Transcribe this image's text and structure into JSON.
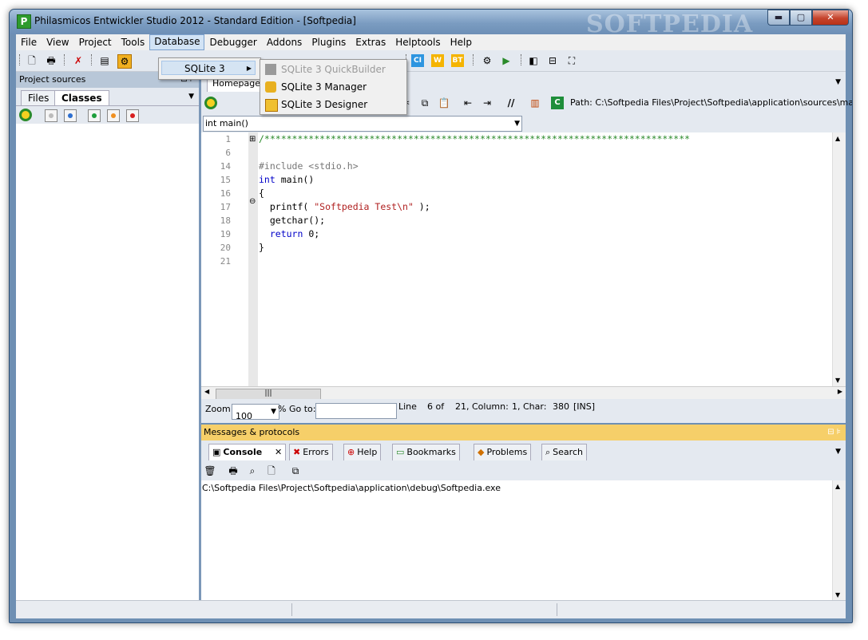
{
  "window": {
    "title": "Philasmicos Entwickler Studio 2012 - Standard Edition - [Softpedia]",
    "watermark": "SOFTPEDIA",
    "app_icon_letter": "P"
  },
  "window_buttons": {
    "minimize": "▬",
    "maximize": "▢",
    "close": "✕"
  },
  "menubar": {
    "items": [
      "File",
      "View",
      "Project",
      "Tools",
      "Database",
      "Debugger",
      "Addons",
      "Plugins",
      "Extras",
      "Helptools",
      "Help"
    ],
    "active": "Database"
  },
  "database_menu": {
    "item": "SQLite 3"
  },
  "sqlite_submenu": {
    "items": [
      {
        "label": "SQLite 3 QuickBuilder",
        "enabled": false
      },
      {
        "label": "SQLite 3 Manager",
        "enabled": true
      },
      {
        "label": "SQLite 3 Designer",
        "enabled": true
      }
    ]
  },
  "toolbar": {
    "icons": [
      "new-file-icon",
      "print-icon",
      "delete-icon",
      "window-icon",
      "build-icon",
      "ci-icon",
      "w-icon",
      "bt-icon",
      "compile-icon",
      "run-icon",
      "layout-left-icon",
      "layout-split-icon",
      "fullscreen-icon"
    ],
    "badges": {
      "ci": "CI",
      "w": "W",
      "bt": "BT"
    }
  },
  "project_panel": {
    "title": "Project sources",
    "tabs": [
      "Files",
      "Classes"
    ],
    "active_tab": "Classes",
    "pin_glyph": "⊟ ⊧"
  },
  "editor": {
    "tab": "Homepage",
    "path_label": "Path: C:\\Softpedia Files\\Project\\Softpedia\\application\\sources\\main.cpp",
    "function_select": "int main()",
    "line_numbers": [
      "1",
      "6",
      "14",
      "15",
      "16",
      "17",
      "18",
      "19",
      "20",
      "21"
    ],
    "code_lines": [
      {
        "type": "comment",
        "text": "/*****************************************************************************"
      },
      {
        "type": "plain",
        "text": ""
      },
      {
        "type": "pre",
        "text": "#include <stdio.h>"
      },
      {
        "type": "kwline",
        "kw": "int",
        "rest": " main()"
      },
      {
        "type": "plain",
        "text": "{"
      },
      {
        "type": "strline",
        "pre": "  printf( ",
        "str": "\"Softpedia Test\\n\"",
        "post": " );"
      },
      {
        "type": "plain",
        "text": "  getchar();"
      },
      {
        "type": "kwline",
        "kw": "  return",
        "rest": " 0;"
      },
      {
        "type": "plain",
        "text": "}"
      },
      {
        "type": "plain",
        "text": ""
      }
    ],
    "fold_markers": {
      "open": "⊞",
      "close": "⊖"
    }
  },
  "status": {
    "zoom_label": "Zoom:",
    "zoom_value": "100",
    "goto_label": "% Go to:",
    "line_label": "Line",
    "line": "6 of",
    "total": "21, Column:",
    "column": "1, Char:",
    "char": "380",
    "mode": "[INS]"
  },
  "messages": {
    "title": "Messages & protocols",
    "tabs": [
      {
        "label": "Console",
        "icon": "console-icon",
        "active": true
      },
      {
        "label": "Errors",
        "icon": "error-icon",
        "active": false
      },
      {
        "label": "Help",
        "icon": "help-icon",
        "active": false
      },
      {
        "label": "Bookmarks",
        "icon": "bookmark-icon",
        "active": false
      },
      {
        "label": "Problems",
        "icon": "problems-icon",
        "active": false
      },
      {
        "label": "Search",
        "icon": "search-icon",
        "active": false
      }
    ],
    "console_output": "C:\\Softpedia Files\\Project\\Softpedia\\application\\debug\\Softpedia.exe"
  },
  "colors": {
    "messages_header": "#f6cf69",
    "window_frame": "#6e8fb3",
    "comment": "#2a8a2a",
    "keyword": "#0000c8",
    "string": "#b02020"
  }
}
